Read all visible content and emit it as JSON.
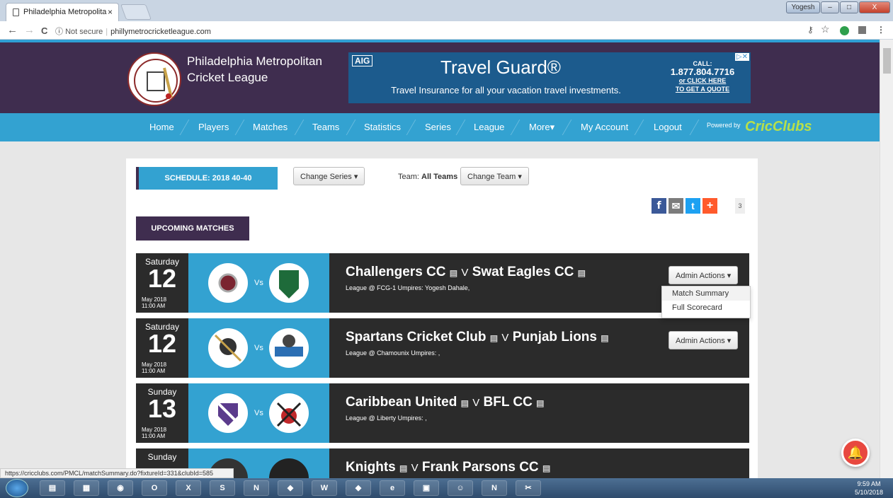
{
  "browser": {
    "tab_title": "Philadelphia Metropolita",
    "tab_close": "×",
    "user_badge": "Yogesh",
    "win_min": "–",
    "win_max": "□",
    "win_close": "X",
    "back": "←",
    "forward": "→",
    "reload": "C",
    "security": "Not secure",
    "url": "phillymetrocricketleague.com"
  },
  "header": {
    "site_name": "Philadelphia Metropolitan Cricket League",
    "ad": {
      "brand": "AIG",
      "title": "Travel Guard®",
      "subtitle": "Travel Insurance for all your vacation travel investments.",
      "call": "CALL:",
      "phone": "1.877.804.7716",
      "or": "or CLICK HERE",
      "quote": "TO GET A QUOTE"
    }
  },
  "menu": [
    "Home",
    "Players",
    "Matches",
    "Teams",
    "Statistics",
    "Series",
    "League",
    "More▾",
    "My Account",
    "Logout"
  ],
  "powered_by": "Powered by",
  "powered_brand": "CricClubs",
  "schedule": {
    "label": "SCHEDULE: 2018 40-40",
    "change_series": "Change Series ▾",
    "team_label": "Team:",
    "team_value": "All Teams",
    "change_team": "Change Team ▾",
    "share_count": "3",
    "upcoming": "UPCOMING MATCHES",
    "vs": "Vs",
    "v": "V",
    "admin_label": "Admin Actions ▾",
    "dropdown": [
      "Match Summary",
      "Full Scorecard"
    ]
  },
  "matches": [
    {
      "day": "Saturday",
      "date": "12",
      "month_year": "May 2018",
      "time": "11:00 AM",
      "team1": "Challengers CC",
      "team2": "Swat Eagles CC",
      "meta": "League @ FCG-1     Umpires: Yogesh Dahale,",
      "admin": true
    },
    {
      "day": "Saturday",
      "date": "12",
      "month_year": "May 2018",
      "time": "11:00 AM",
      "team1": "Spartans Cricket Club",
      "team2": "Punjab Lions",
      "meta": "League @ Chamounix     Umpires: ,",
      "admin": true
    },
    {
      "day": "Sunday",
      "date": "13",
      "month_year": "May 2018",
      "time": "11:00 AM",
      "team1": "Caribbean United",
      "team2": "BFL CC",
      "meta": "League @ Liberty     Umpires: ,",
      "admin": false
    },
    {
      "day": "Sunday",
      "date": "",
      "month_year": "",
      "time": "",
      "team1": "Knights",
      "team2": "Frank Parsons CC",
      "meta": "",
      "admin": false
    }
  ],
  "status_url": "https://cricclubs.com/PMCL/matchSummary.do?fixtureId=331&clubId=585",
  "clock": {
    "time": "9:59 AM",
    "date": "5/10/2018"
  }
}
